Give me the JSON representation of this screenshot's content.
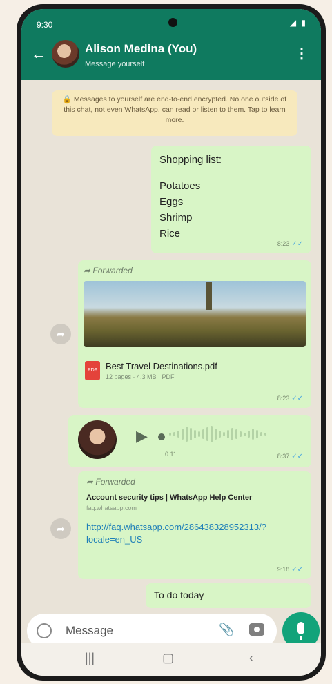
{
  "status": {
    "time": "9:30",
    "icons": "◢ ▮"
  },
  "header": {
    "title": "Alison Medina (You)",
    "subtitle": "Message yourself"
  },
  "notice": {
    "text": "🔒 Messages to yourself are end-to-end encrypted. No one outside of this chat, not even WhatsApp, can read or listen to them. Tap to learn more."
  },
  "messages": {
    "shopping": {
      "title": "Shopping list:",
      "items": [
        "Potatoes",
        "Eggs",
        "Shrimp",
        "Rice"
      ],
      "time": "8:23"
    },
    "forwarded_doc": {
      "label": "Forwarded",
      "file_name": "Best Travel Destinations.pdf",
      "meta": "12 pages · 4.3 MB · PDF",
      "time": "8:23"
    },
    "voice": {
      "duration": "0:11",
      "time": "8:37"
    },
    "link": {
      "label": "Forwarded",
      "title": "Account security tips | WhatsApp Help Center",
      "host": "faq.whatsapp.com",
      "url": "http://faq.whatsapp.com/286438328952313/?locale=en_US",
      "time": "9:18"
    },
    "todo": {
      "text": "To do today"
    }
  },
  "composer": {
    "placeholder": "Message"
  },
  "colors": {
    "header": "#0f7a5f",
    "bubble": "#d8f5c6",
    "mic": "#12a37a"
  }
}
